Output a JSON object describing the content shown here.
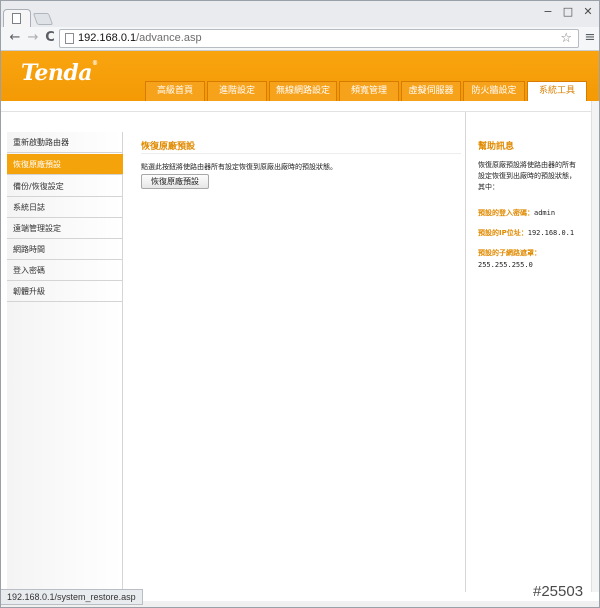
{
  "browser": {
    "url_host": "192.168.0.1",
    "url_path": "/advance.asp",
    "status_url": "192.168.0.1/system_restore.asp",
    "back_glyph": "←",
    "forward_glyph": "→",
    "reload_glyph": "C",
    "star_glyph": "☆",
    "menu_glyph": "≡",
    "minimize_glyph": "−",
    "maximize_glyph": "□",
    "close_glyph": "✕"
  },
  "header": {
    "logo": "Tenda",
    "logo_mark": "®",
    "brand_color": "#f5a30a"
  },
  "nav_tabs": [
    {
      "label": "高級首頁"
    },
    {
      "label": "進階設定"
    },
    {
      "label": "無線網路設定"
    },
    {
      "label": "頻寬管理"
    },
    {
      "label": "虛擬伺服器"
    },
    {
      "label": "防火牆設定"
    },
    {
      "label": "系統工具",
      "active": true
    }
  ],
  "sidebar": {
    "items": [
      {
        "label": "重新啟動路由器"
      },
      {
        "label": "恢復原廠預設",
        "active": true
      },
      {
        "label": "備份/恢復設定"
      },
      {
        "label": "系統日誌"
      },
      {
        "label": "遠端管理設定"
      },
      {
        "label": "網路時間"
      },
      {
        "label": "登入密碼"
      },
      {
        "label": "韌體升級"
      }
    ]
  },
  "main": {
    "title": "恢復原廠預設",
    "description": "點選此按鈕將使路由器所有設定恢復到原廠出廠時的預設狀態。",
    "restore_button": "恢復原廠預設"
  },
  "help": {
    "title": "幫助訊息",
    "text": "恢復原廠預設將使路由器的所有設定恢復到出廠時的預設狀態，其中：",
    "password_label": "預設的登入密碼：",
    "password_value": "admin",
    "ip_label": "預設的IP位址：",
    "ip_value": "192.168.0.1",
    "mask_label": "預設的子網路遮罩：",
    "mask_value": "255.255.255.0"
  },
  "watermark": "#25503"
}
